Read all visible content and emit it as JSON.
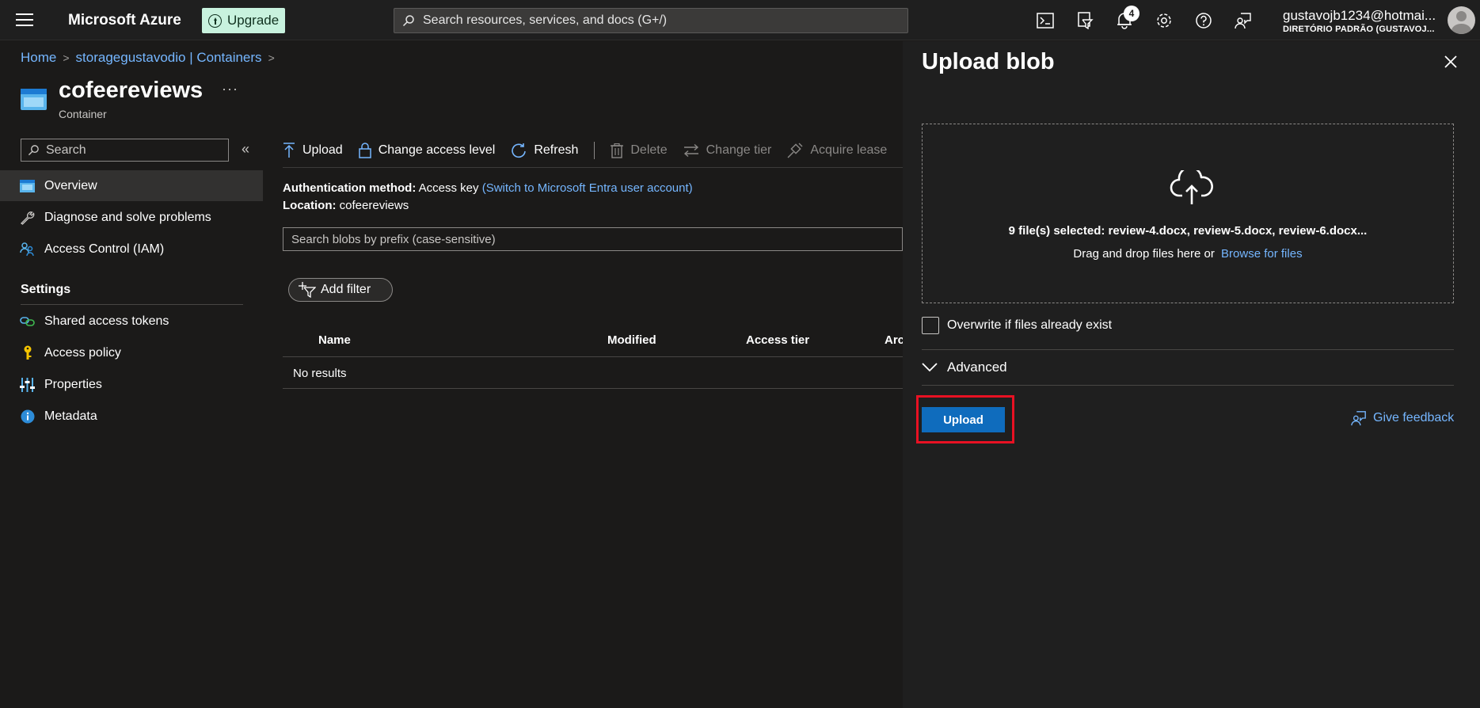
{
  "topbar": {
    "brand": "Microsoft Azure",
    "upgrade_label": "Upgrade",
    "search_placeholder": "Search resources, services, and docs (G+/)",
    "notification_count": "4",
    "user_email": "gustavojb1234@hotmai...",
    "user_directory": "DIRETÓRIO PADRÃO (GUSTAVOJ...",
    "icons": [
      "cloud-shell-icon",
      "directory-filter-icon",
      "notifications-icon",
      "settings-icon",
      "help-icon",
      "feedback-icon"
    ]
  },
  "breadcrumb": {
    "home": "Home",
    "storage": "storagegustavodio | Containers"
  },
  "page": {
    "title": "cofeereviews",
    "more": "···",
    "subtitle": "Container"
  },
  "sidebar": {
    "search_placeholder": "Search",
    "collapse": "«",
    "items": [
      {
        "label": "Overview"
      },
      {
        "label": "Diagnose and solve problems"
      },
      {
        "label": "Access Control (IAM)"
      }
    ],
    "settings_heading": "Settings",
    "settings_items": [
      {
        "label": "Shared access tokens"
      },
      {
        "label": "Access policy"
      },
      {
        "label": "Properties"
      },
      {
        "label": "Metadata"
      }
    ]
  },
  "toolbar": {
    "upload": "Upload",
    "change_access": "Change access level",
    "refresh": "Refresh",
    "delete": "Delete",
    "change_tier": "Change tier",
    "acquire_lease": "Acquire lease"
  },
  "info": {
    "auth_label": "Authentication method:",
    "auth_value": "Access key",
    "auth_link": "(Switch to Microsoft Entra user account)",
    "location_label": "Location:",
    "location_value": "cofeereviews"
  },
  "blob_search_placeholder": "Search blobs by prefix (case-sensitive)",
  "add_filter": "Add filter",
  "table": {
    "columns": [
      "Name",
      "Modified",
      "Access tier",
      "Arc"
    ],
    "empty": "No results"
  },
  "panel": {
    "title": "Upload blob",
    "selected_text": "9 file(s) selected: review-4.docx, review-5.docx, review-6.docx...",
    "drag_text": "Drag and drop files here  or",
    "browse_link": "Browse for files",
    "overwrite_label": "Overwrite if files already exist",
    "overwrite_checked": false,
    "advanced_label": "Advanced",
    "upload_button": "Upload",
    "feedback": "Give feedback"
  },
  "colors": {
    "accent": "#0f6cbd",
    "link": "#75b6ff",
    "highlight": "#e81123",
    "upgrade_bg": "#c8f2de"
  }
}
